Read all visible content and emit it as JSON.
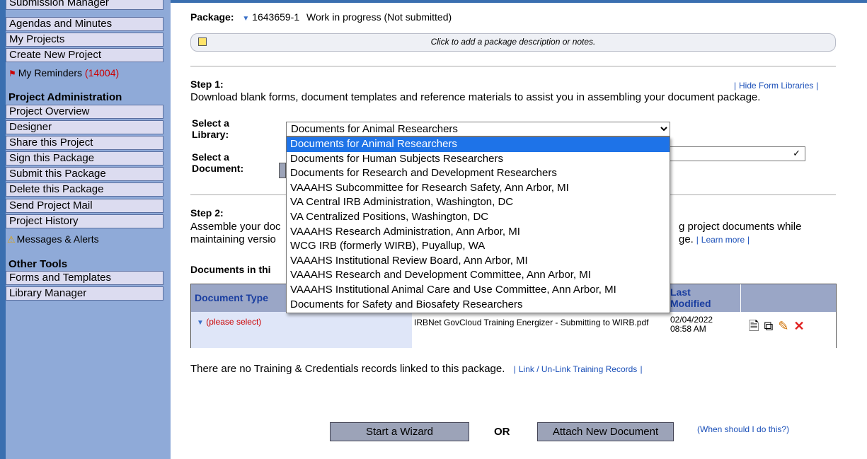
{
  "sidebar": {
    "top_items": [
      "Submission Manager",
      "Agendas and Minutes",
      "My Projects",
      "Create New Project"
    ],
    "reminders": {
      "label": "My Reminders",
      "count": "(14004)"
    },
    "project_admin_heading": "Project Administration",
    "project_admin_items": [
      "Project Overview",
      "Designer",
      "Share this Project",
      "Sign this Package",
      "Submit this Package",
      "Delete this Package",
      "Send Project Mail",
      "Project History"
    ],
    "messages_label": "Messages & Alerts",
    "other_tools_heading": "Other Tools",
    "other_tools_items": [
      "Forms and Templates",
      "Library Manager"
    ]
  },
  "package": {
    "label": "Package:",
    "id": "1643659-1",
    "status": "Work in progress (Not submitted)",
    "note_placeholder": "Click to add a package description or notes."
  },
  "step1": {
    "title": "Step 1:",
    "hide_link": "Hide Form Libraries",
    "description": "Download blank forms, document templates and reference materials to assist you in assembling your document package.",
    "library_label_1": "Select a",
    "library_label_2": "Library:",
    "document_label_1": "Select a",
    "document_label_2": "Document:",
    "library_selected": "Documents for Animal Researchers",
    "library_options": [
      "Documents for Animal Researchers",
      "Documents for Human Subjects Researchers",
      "Documents for Research and Development Researchers",
      "VAAAHS Subcommittee for Research Safety, Ann Arbor, MI",
      "VA Central IRB Administration, Washington, DC",
      "VA Centralized Positions, Washington, DC",
      "VAAAHS Research Administration, Ann Arbor, MI",
      "WCG IRB (formerly WIRB), Puyallup, WA",
      "VAAAHS Institutional Review Board, Ann Arbor, MI",
      "VAAAHS Research and Development Committee, Ann Arbor, MI",
      "VAAAHS Institutional Animal Care and Use Committee, Ann Arbor, MI",
      "Documents for Safety and Biosafety Researchers"
    ]
  },
  "step2": {
    "title": "Step 2:",
    "line1_start": "Assemble your doc",
    "line1_end": "g project documents while",
    "line2_start": "maintaining versio",
    "line2_end": "ge.",
    "learn_more": "Learn more",
    "docs_heading": "Documents in thi"
  },
  "table": {
    "col_type": "Document Type",
    "col_modified_1": "Last",
    "col_modified_2": "Modified",
    "row": {
      "type": "(please select)",
      "file": "IRBNet GovCloud Training Energizer - Submitting to WIRB.pdf",
      "date": "02/04/2022",
      "time": "08:58 AM"
    }
  },
  "training": {
    "text": "There are no Training & Credentials records linked to this package.",
    "link": "Link / Un-Link Training Records"
  },
  "actions": {
    "wizard": "Start a Wizard",
    "or": "OR",
    "attach": "Attach New Document",
    "when": "(When should I do this?)"
  }
}
